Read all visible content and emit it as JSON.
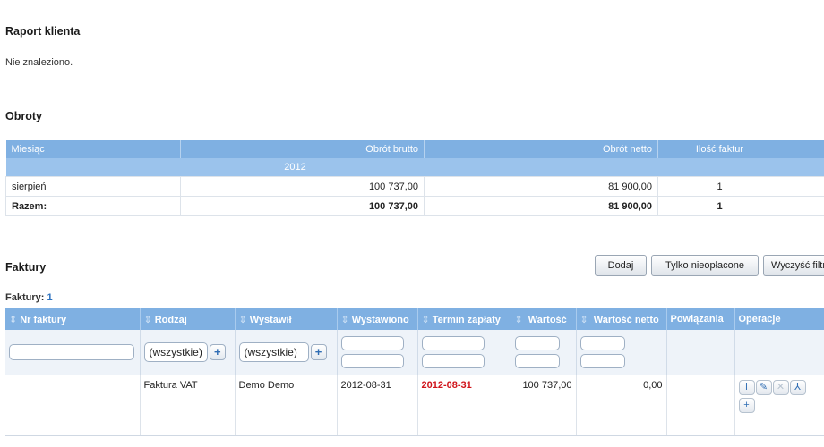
{
  "sections": {
    "raport_title": "Raport klienta",
    "raport_message": "Nie znaleziono.",
    "obroty_title": "Obroty",
    "faktury_title": "Faktury"
  },
  "obroty": {
    "headers": [
      "Miesiąc",
      "Obrót brutto",
      "Obrót netto",
      "Ilość faktur"
    ],
    "year": "2012",
    "rows": [
      {
        "month": "sierpień",
        "brutto": "100 737,00",
        "netto": "81 900,00",
        "count": "1"
      }
    ],
    "total": {
      "label": "Razem:",
      "brutto": "100 737,00",
      "netto": "81 900,00",
      "count": "1"
    }
  },
  "toolbar": {
    "add_label": "Dodaj",
    "unpaid_label": "Tylko nieopłacone",
    "clear_label": "Wyczyść filtry"
  },
  "faktury": {
    "count_label": "Faktury:",
    "count_value": "1",
    "headers": [
      "Nr faktury",
      "Rodzaj",
      "Wystawił",
      "Wystawiono",
      "Termin zapłaty",
      "Wartość",
      "Wartość netto",
      "Powiązania",
      "Operacje"
    ],
    "filter_rodzaj": "(wszystkie)",
    "filter_wystawil": "(wszystkie)",
    "row": {
      "nr": "",
      "rodzaj": "Faktura VAT",
      "wystawil": "Demo Demo",
      "wystawiono": "2012-08-31",
      "termin": "2012-08-31",
      "wartosc": "100 737,00",
      "netto": "0,00",
      "powiazania": ""
    },
    "operation_icons": [
      "info-icon",
      "edit-icon",
      "delete-icon",
      "pdf-icon",
      "plus-icon"
    ]
  }
}
